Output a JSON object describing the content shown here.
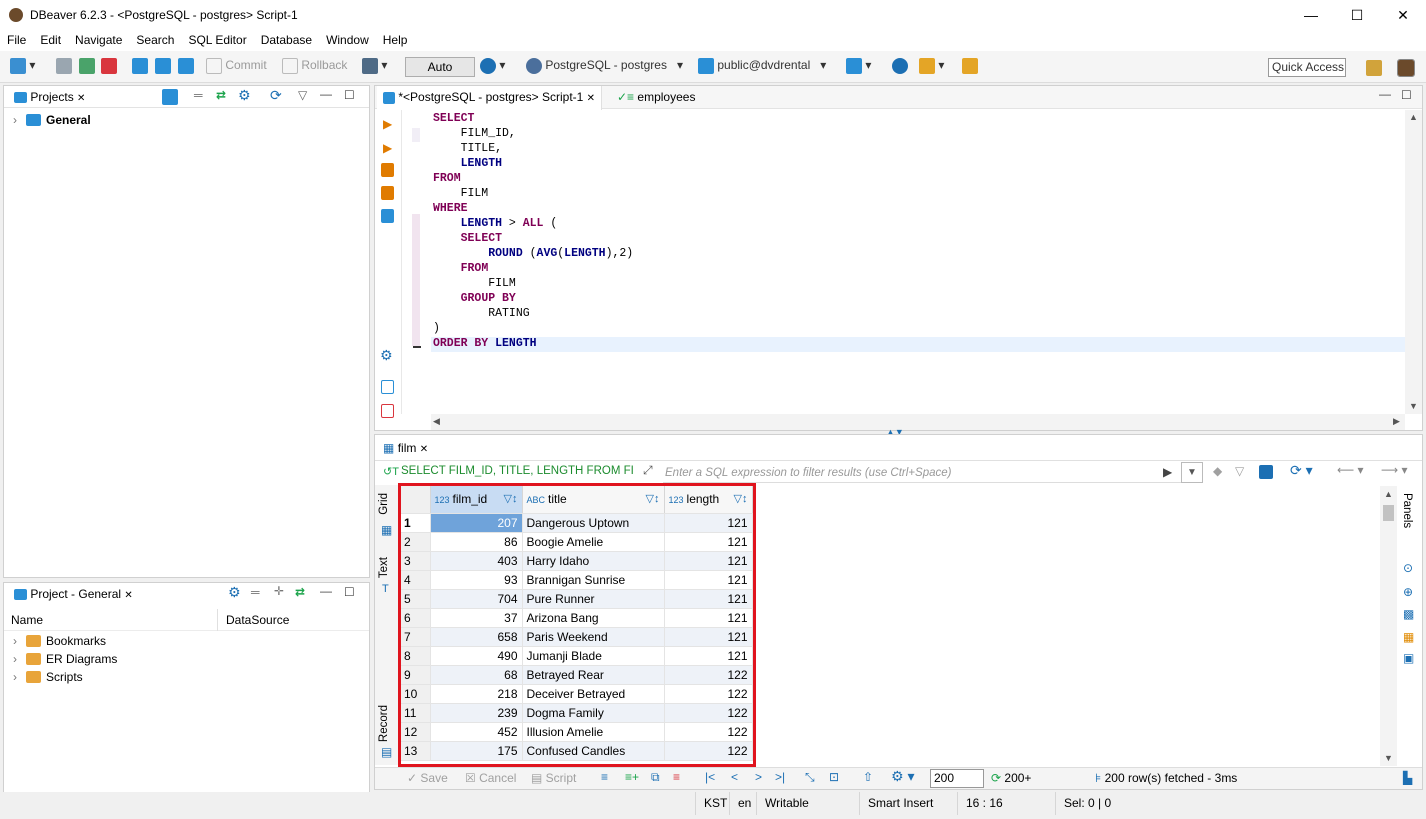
{
  "window": {
    "title": "DBeaver 6.2.3 - <PostgreSQL - postgres> Script-1",
    "minimize": "—",
    "maximize": "☐",
    "close": "✕"
  },
  "menu": [
    "File",
    "Edit",
    "Navigate",
    "Search",
    "SQL Editor",
    "Database",
    "Window",
    "Help"
  ],
  "toolbar": {
    "commit": "Commit",
    "rollback": "Rollback",
    "tx_mode": "Auto",
    "connection": "PostgreSQL - postgres",
    "schema": "public@dvdrental",
    "quick_access": "Quick Access"
  },
  "projects": {
    "tab": "Projects",
    "root": "General"
  },
  "project_general": {
    "tab": "Project - General",
    "col_name": "Name",
    "col_ds": "DataSource",
    "items": [
      "Bookmarks",
      "ER Diagrams",
      "Scripts"
    ]
  },
  "editor": {
    "tab_active": "*<PostgreSQL - postgres> Script-1",
    "tab_other": "employees",
    "lines": [
      [
        [
          "kw",
          "SELECT"
        ]
      ],
      [
        [
          "t",
          "    FILM_ID,"
        ]
      ],
      [
        [
          "t",
          "    TITLE,"
        ]
      ],
      [
        [
          "t",
          "    "
        ],
        [
          "kw2",
          "LENGTH"
        ]
      ],
      [
        [
          "kw",
          "FROM"
        ]
      ],
      [
        [
          "t",
          "    FILM"
        ]
      ],
      [
        [
          "kw",
          "WHERE"
        ]
      ],
      [
        [
          "t",
          "    "
        ],
        [
          "kw2",
          "LENGTH"
        ],
        [
          "t",
          " > "
        ],
        [
          "kw",
          "ALL"
        ],
        [
          "t",
          " ("
        ]
      ],
      [
        [
          "t",
          "    "
        ],
        [
          "kw",
          "SELECT"
        ]
      ],
      [
        [
          "t",
          "        "
        ],
        [
          "kw2",
          "ROUND"
        ],
        [
          "t",
          " ("
        ],
        [
          "kw2",
          "AVG"
        ],
        [
          "t",
          "("
        ],
        [
          "kw2",
          "LENGTH"
        ],
        [
          "t",
          "),2)"
        ]
      ],
      [
        [
          "t",
          "    "
        ],
        [
          "kw",
          "FROM"
        ]
      ],
      [
        [
          "t",
          "        FILM"
        ]
      ],
      [
        [
          "t",
          "    "
        ],
        [
          "kw",
          "GROUP BY"
        ]
      ],
      [
        [
          "t",
          "        RATING"
        ]
      ],
      [
        [
          "t",
          ")"
        ]
      ],
      [
        [
          "kw",
          "ORDER BY"
        ],
        [
          "t",
          " "
        ],
        [
          "kw2",
          "LENGTH"
        ]
      ]
    ]
  },
  "results": {
    "tab": "film",
    "query": "SELECT FILM_ID, TITLE, LENGTH FROM FILM",
    "filter_placeholder": "Enter a SQL expression to filter results (use Ctrl+Space)",
    "side_tabs": {
      "grid": "Grid",
      "text": "Text",
      "record": "Record",
      "panels": "Panels"
    },
    "columns": [
      {
        "type": "123",
        "name": "film_id"
      },
      {
        "type": "ABC",
        "name": "title"
      },
      {
        "type": "123",
        "name": "length"
      }
    ],
    "rows": [
      [
        "1",
        "207",
        "Dangerous Uptown",
        "121"
      ],
      [
        "2",
        "86",
        "Boogie Amelie",
        "121"
      ],
      [
        "3",
        "403",
        "Harry Idaho",
        "121"
      ],
      [
        "4",
        "93",
        "Brannigan Sunrise",
        "121"
      ],
      [
        "5",
        "704",
        "Pure Runner",
        "121"
      ],
      [
        "6",
        "37",
        "Arizona Bang",
        "121"
      ],
      [
        "7",
        "658",
        "Paris Weekend",
        "121"
      ],
      [
        "8",
        "490",
        "Jumanji Blade",
        "121"
      ],
      [
        "9",
        "68",
        "Betrayed Rear",
        "122"
      ],
      [
        "10",
        "218",
        "Deceiver Betrayed",
        "122"
      ],
      [
        "11",
        "239",
        "Dogma Family",
        "122"
      ],
      [
        "12",
        "452",
        "Illusion Amelie",
        "122"
      ],
      [
        "13",
        "175",
        "Confused Candles",
        "122"
      ]
    ],
    "bottom": {
      "save": "Save",
      "cancel": "Cancel",
      "script": "Script",
      "fetch_size": "200",
      "fetch_more": "200+",
      "fetched": "200 row(s) fetched - 3ms"
    }
  },
  "statusbar": {
    "tz": "KST",
    "lang": "en",
    "mode": "Writable",
    "insert": "Smart Insert",
    "pos": "16 : 16",
    "sel": "Sel: 0 | 0"
  }
}
